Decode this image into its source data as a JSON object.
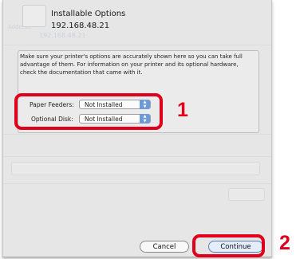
{
  "dialog": {
    "title": "Installable Options",
    "ip_address": "192.168.48.21",
    "description": "Make sure your printer's options are accurately shown here so you can take full advantage of them.  For information on your printer and its optional hardware, check the documentation that came with it."
  },
  "options": [
    {
      "label": "Paper Feeders:",
      "value": "Not Installed"
    },
    {
      "label": "Optional Disk:",
      "value": "Not Installed"
    }
  ],
  "buttons": {
    "cancel": "Cancel",
    "continue": "Continue"
  },
  "callouts": {
    "options_number": "1",
    "continue_number": "2",
    "color": "#e0001b"
  },
  "background_dialog": {
    "ip_field": "192.168.48.21"
  }
}
